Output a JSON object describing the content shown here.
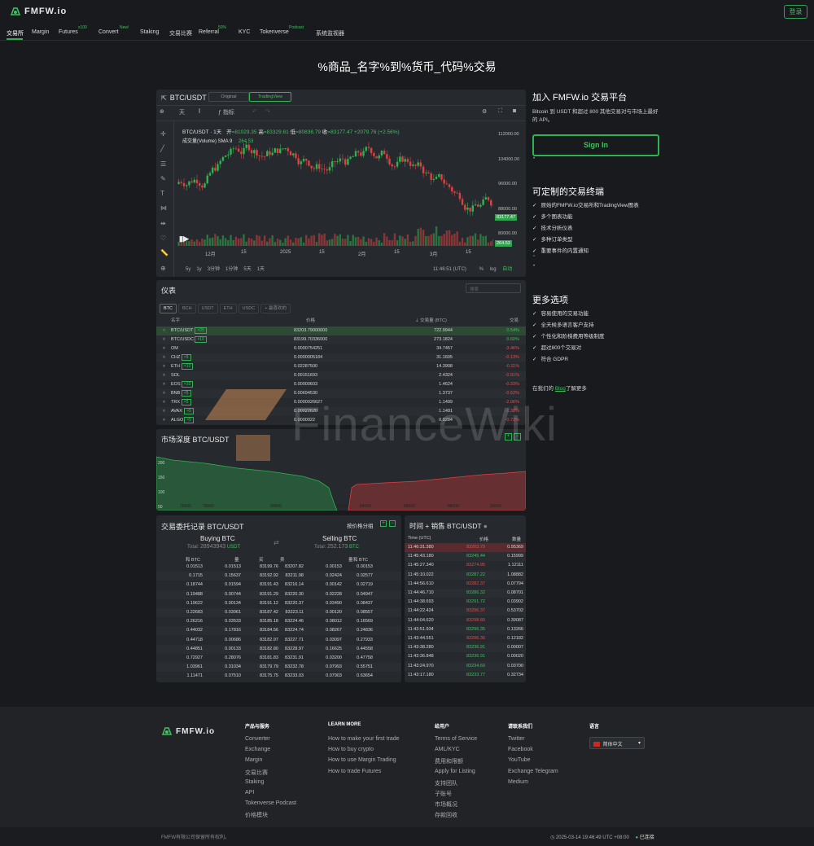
{
  "brand": {
    "name": "FMFW.io",
    "login": "登录"
  },
  "nav": [
    {
      "label": "交易所",
      "badge": ""
    },
    {
      "label": "Margin",
      "badge": ""
    },
    {
      "label": "Futures",
      "badge": "x100"
    },
    {
      "label": "Convert",
      "badge": "New!"
    },
    {
      "label": "Staking",
      "badge": ""
    },
    {
      "label": "交易比赛",
      "badge": ""
    },
    {
      "label": "Referral",
      "badge": "50%"
    },
    {
      "label": "KYC",
      "badge": ""
    },
    {
      "label": "Tokenverse",
      "badge": "Podcast"
    },
    {
      "label": "系统监视器",
      "badge": ""
    }
  ],
  "page_title": "%商品_名字%到%货币_代码%交易",
  "chart": {
    "pair": "BTC/USDT",
    "tab_original": "Original",
    "tab_tv": "TradingView",
    "toolbar": {
      "interval": "天",
      "indicators": "指标"
    },
    "legend": {
      "title": "BTC/USDT · 1天",
      "open_label": "开",
      "open": "=81029.35",
      "high_label": "高",
      "high": "=83329.61",
      "low_label": "低",
      "low": "=80838.79",
      "close_label": "收",
      "close": "=83177.47",
      "change": "+2079.76 (+2.56%)"
    },
    "volume_label": "成交量(Volume) SMA 9",
    "volume_value": "264.53",
    "price_ticks": [
      "112000.00",
      "104000.00",
      "96000.00",
      "88000.00",
      "80000.00"
    ],
    "last_price": "83177.47",
    "last_volume": "264.53",
    "date_ticks": [
      "12月",
      "15",
      "2025",
      "15",
      "2月",
      "15",
      "3月",
      "15"
    ],
    "ranges": [
      "5y",
      "1y",
      "3分钟",
      "1分钟",
      "5天",
      "1天"
    ],
    "time": "11:46:51 (UTC)",
    "pct": "%",
    "log": "log",
    "auto": "自动"
  },
  "ticker": {
    "title": "仪表",
    "search_placeholder": "搜索",
    "tabs": [
      "BTC",
      "BCH",
      "USDT",
      "ETH",
      "USDC",
      "+ 最喜欢的"
    ],
    "headers": {
      "name": "名字",
      "price": "价格",
      "volume": "交易量 (BTC)",
      "change": "交易"
    },
    "rows": [
      {
        "name": "BTC/USDT",
        "lev": "×25",
        "price": "83203.79000000",
        "volume": "722.9944",
        "change": "0.54%",
        "up": true
      },
      {
        "name": "BTC/USDC",
        "lev": "×10",
        "price": "83199.70336000",
        "volume": "273.1824",
        "change": "0.60%",
        "up": true
      },
      {
        "name": "OM",
        "lev": "",
        "price": "0.0000754251",
        "volume": "34.7457",
        "change": "-3.46%",
        "up": false
      },
      {
        "name": "CHZ",
        "lev": "×5",
        "price": "0.0000005184",
        "volume": "31.1605",
        "change": "-0.13%",
        "up": false
      },
      {
        "name": "ETH",
        "lev": "×10",
        "price": "0.02287500",
        "volume": "14.3908",
        "change": "-0.11%",
        "up": false
      },
      {
        "name": "SOL",
        "lev": "",
        "price": "0.00151693",
        "volume": "2.4324",
        "change": "-0.91%",
        "up": false
      },
      {
        "name": "EOS",
        "lev": "×10",
        "price": "0.00000603",
        "volume": "1.4624",
        "change": "-0.33%",
        "up": false
      },
      {
        "name": "BNB",
        "lev": "×5",
        "price": "0.00694530",
        "volume": "1.3737",
        "change": "-0.62%",
        "up": false
      },
      {
        "name": "TRX",
        "lev": "×5",
        "price": "0.0000026627",
        "volume": "1.1499",
        "change": "-2.06%",
        "up": false
      },
      {
        "name": "AVAX",
        "lev": "×5",
        "price": "0.00022620",
        "volume": "1.1491",
        "change": "-1.38%",
        "up": false
      },
      {
        "name": "ALGO",
        "lev": "×5",
        "price": "0.0000022",
        "volume": "0.9284",
        "change": "-0.72%",
        "up": false
      }
    ]
  },
  "depth": {
    "title": "市场深度 BTC/USDT",
    "y_ticks": [
      "200",
      "150",
      "100",
      "50"
    ],
    "x_ticks": [
      "76000",
      "78000",
      "80000",
      "82000",
      "84000",
      "86000",
      "88000",
      "90000"
    ]
  },
  "orderbook": {
    "title": "交易委托记录 BTC/USDT",
    "grouping": "按价格分组",
    "buy_title": "Buying BTC",
    "buy_total_label": "Total:",
    "buy_total": "28943943",
    "buy_unit": "USDT",
    "sell_title": "Selling BTC",
    "sell_total_label": "Total:",
    "sell_total": "252.173",
    "sell_unit": "BTC",
    "headers": [
      "和 BTC",
      "量",
      "买",
      "卖",
      "量",
      "和 BTC"
    ],
    "rows": [
      [
        "0.01513",
        "0.01513",
        "83199.76",
        "83207.82",
        "0.00153",
        "0.00153"
      ],
      [
        "0.1715",
        "0.15637",
        "83192.92",
        "83211.98",
        "0.02424",
        "0.02577"
      ],
      [
        "0.18744",
        "0.01594",
        "83191.43",
        "83216.14",
        "0.00142",
        "0.02719"
      ],
      [
        "0.19488",
        "0.00744",
        "83191.29",
        "83220.30",
        "0.02228",
        "0.04947"
      ],
      [
        "0.19622",
        "0.00134",
        "83191.12",
        "83220.37",
        "0.03490",
        "0.08437"
      ],
      [
        "0.22683",
        "0.03061",
        "83187.42",
        "83223.11",
        "0.00120",
        "0.08557"
      ],
      [
        "0.26216",
        "0.03533",
        "83185.18",
        "83224.46",
        "0.08012",
        "0.16569"
      ],
      [
        "0.44032",
        "0.17816",
        "83184.56",
        "83224.74",
        "0.08267",
        "0.24836"
      ],
      [
        "0.44718",
        "0.00686",
        "83182.97",
        "83227.71",
        "0.03097",
        "0.27933"
      ],
      [
        "0.44851",
        "0.00133",
        "83182.80",
        "83228.97",
        "0.16625",
        "0.44558"
      ],
      [
        "0.72927",
        "0.28076",
        "83181.83",
        "83231.91",
        "0.03200",
        "0.47758"
      ],
      [
        "1.03961",
        "0.31034",
        "83179.79",
        "83232.78",
        "0.07993",
        "0.55751"
      ],
      [
        "1.11471",
        "0.07510",
        "83175.75",
        "83233.03",
        "0.07903",
        "0.63654"
      ]
    ]
  },
  "trades": {
    "title": "时间 + 销售 BTC/USDT",
    "headers": [
      "Time (UTC)",
      "价格",
      "数量"
    ],
    "rows": [
      [
        "11:46:31.380",
        "83203.79",
        "0.95369",
        false
      ],
      [
        "11:45:43.180",
        "83245.44",
        "0.15999",
        true
      ],
      [
        "11:45:27.340",
        "83274.95",
        "1.12111",
        false
      ],
      [
        "11:45:10.022",
        "83287.22",
        "1.08882",
        true
      ],
      [
        "11:44:56.610",
        "83282.37",
        "0.07794",
        false
      ],
      [
        "11:44:46.710",
        "83286.32",
        "0.08701",
        true
      ],
      [
        "11:44:38.693",
        "83291.72",
        "0.03902",
        true
      ],
      [
        "11:44:22.424",
        "83296.37",
        "0.53702",
        false
      ],
      [
        "11:44:04.620",
        "83298.80",
        "0.39087",
        false
      ],
      [
        "11:43:51.934",
        "83296.35",
        "0.13266",
        true
      ],
      [
        "11:43:44.551",
        "83296.36",
        "0.12182",
        false
      ],
      [
        "11:43:38.280",
        "83236.91",
        "0.00007",
        true
      ],
      [
        "11:43:36.848",
        "83236.91",
        "0.00020",
        true
      ],
      [
        "11:43:24.970",
        "83234.60",
        "0.03700",
        true
      ],
      [
        "11:43:17.180",
        "83233.77",
        "0.32734",
        true
      ]
    ]
  },
  "side": {
    "join_title": "加入 FMFW.io 交易平台",
    "join_text": "Bitcoin 到 USDT 和超过 800 其他交易对与市场上最好的 API。",
    "signin": "Sign In",
    "custom_title": "可定制的交易终端",
    "custom_items": [
      "原始的FMFW.io交易所和TradingView图表",
      "多个图表功能",
      "技术分析仪表",
      "多种订单类型",
      "重要事件的内置通知"
    ],
    "more_title": "更多选项",
    "more_items": [
      "容易使用的交易功能",
      "全天候多语言客户支持",
      "个性化和阶梯费用等级制度",
      "超过800个交易对",
      "符合 GDPR"
    ],
    "blog_pre": "在我们的",
    "blog_link": "Blog",
    "blog_post": "了解更多"
  },
  "watermark": "FinanceWiki",
  "footer": {
    "cols": [
      {
        "title": "产品与服务",
        "links": [
          "Converter",
          "Exchange",
          "Margin",
          "交易比赛",
          "Staking",
          "API",
          "Tokenverse Podcast",
          "价格模块"
        ]
      },
      {
        "title": "LEARN MORE",
        "links": [
          "How to make your first trade",
          "How to buy crypto",
          "How to use Margin Trading",
          "How to trade Futures"
        ]
      },
      {
        "title": "给用户",
        "links": [
          "Terms of Service",
          "AML/KYC",
          "费用和限额",
          "Apply for Listing",
          "支持团队",
          "子账号",
          "市场概况",
          "存款回收"
        ]
      },
      {
        "title": "请联系我们",
        "links": [
          "Twitter",
          "Facebook",
          "YouTube",
          "Exchange Telegram",
          "Medium"
        ]
      },
      {
        "title": "语言",
        "links": []
      }
    ],
    "language": "简体中文",
    "copyright": "FMFW有限公司保留所有权利。",
    "datetime": "2025-03-14 19:46:49 UTC +08:00",
    "status": "已连接"
  }
}
